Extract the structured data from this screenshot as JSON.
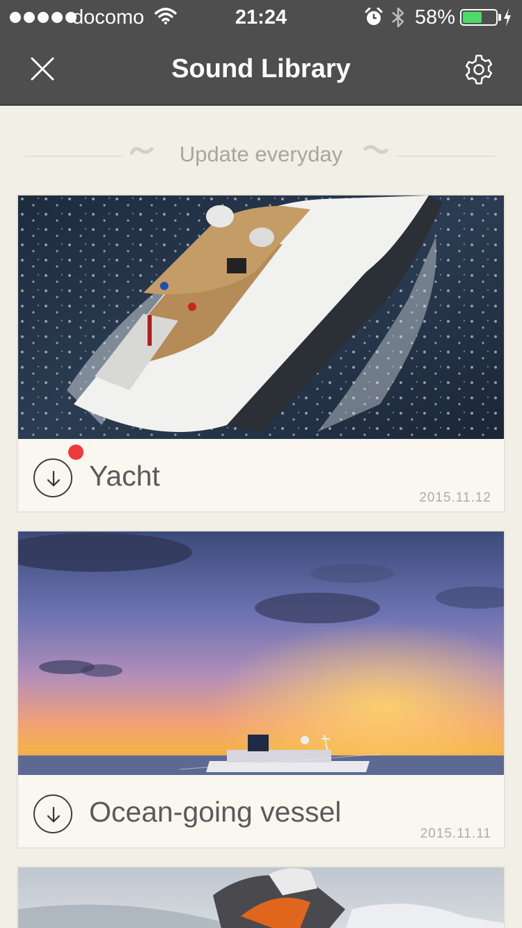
{
  "status_bar": {
    "carrier": "docomo",
    "time": "21:24",
    "battery_percent": "58%",
    "battery_level": 0.58,
    "signal_dots": 5,
    "icons": [
      "wifi-icon",
      "alarm-icon",
      "bluetooth-icon",
      "battery-icon",
      "charging-icon"
    ]
  },
  "nav": {
    "title": "Sound Library",
    "close_icon": "close-icon",
    "settings_icon": "gear-icon"
  },
  "section": {
    "header": "Update everyday"
  },
  "sounds": [
    {
      "title": "Yacht",
      "date": "2015.11.12",
      "is_new": true,
      "image": "yacht-aerial-photo"
    },
    {
      "title": "Ocean-going vessel",
      "date": "2015.11.11",
      "is_new": false,
      "image": "ship-at-sunset-photo"
    },
    {
      "title": "",
      "date": "",
      "is_new": false,
      "image": "jet-ski-photo"
    }
  ],
  "colors": {
    "bar_background": "#4e4e4e",
    "page_background": "#f1efe6",
    "card_background": "#f9f7f0",
    "new_badge": "#f03a3a",
    "battery_fill": "#4cd964"
  }
}
